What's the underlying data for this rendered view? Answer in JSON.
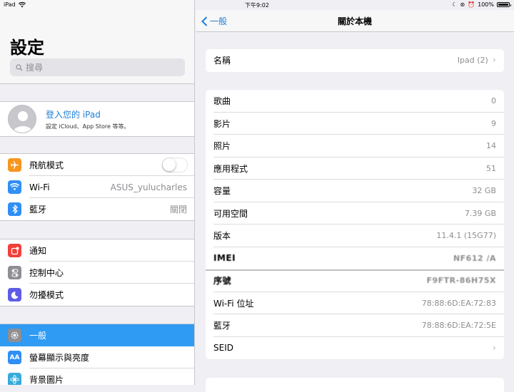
{
  "status": {
    "device": "iPad",
    "time": "下午9:02",
    "battery": "100%",
    "battery_level": 1.0
  },
  "master": {
    "title": "設定",
    "search_placeholder": "搜尋",
    "profile": {
      "title": "登入您的 iPad",
      "subtitle": "設定 iCloud、App Store 等等。"
    },
    "group1": [
      {
        "label": "飛航模式",
        "icon": "airplane-icon",
        "color": "#f7961e",
        "toggle": false
      },
      {
        "label": "Wi-Fi",
        "icon": "wifi-icon",
        "color": "#2f8ff5",
        "value": "ASUS_yulucharles"
      },
      {
        "label": "藍牙",
        "icon": "bluetooth-icon",
        "color": "#2f8ff5",
        "value": "關閉"
      }
    ],
    "group2": [
      {
        "label": "通知",
        "icon": "notification-icon",
        "color": "#f2403a"
      },
      {
        "label": "控制中心",
        "icon": "control-center-icon",
        "color": "#8e8e93"
      },
      {
        "label": "勿擾模式",
        "icon": "moon-icon",
        "color": "#5e5ce6"
      }
    ],
    "group3": [
      {
        "label": "一般",
        "icon": "gear-icon",
        "color": "#8e8e93",
        "selected": true
      },
      {
        "label": "螢幕顯示與亮度",
        "icon": "display-icon",
        "color": "#2f8ff5"
      },
      {
        "label": "背景圖片",
        "icon": "wallpaper-icon",
        "color": "#37aadc"
      }
    ]
  },
  "detail": {
    "back_label": "一般",
    "title": "關於本機",
    "name_row": {
      "label": "名稱",
      "value": "Ipad (2)"
    },
    "info_rows": [
      {
        "label": "歌曲",
        "value": "0"
      },
      {
        "label": "影片",
        "value": "9"
      },
      {
        "label": "照片",
        "value": "14"
      },
      {
        "label": "應用程式",
        "value": "51"
      },
      {
        "label": "容量",
        "value": "32 GB"
      },
      {
        "label": "可用空間",
        "value": "7.39 GB"
      },
      {
        "label": "版本",
        "value": "11.4.1 (15G77)"
      },
      {
        "label": "IMEI",
        "value": "NF612 /A"
      },
      {
        "label": "序號",
        "value": "F9FTR-86H75X"
      },
      {
        "label": "Wi-Fi 位址",
        "value": "78:88:6D:EA:72:83"
      },
      {
        "label": "藍牙",
        "value": "78:88:6D:EA:72:5E"
      },
      {
        "label": "SEID",
        "value": ""
      }
    ]
  }
}
